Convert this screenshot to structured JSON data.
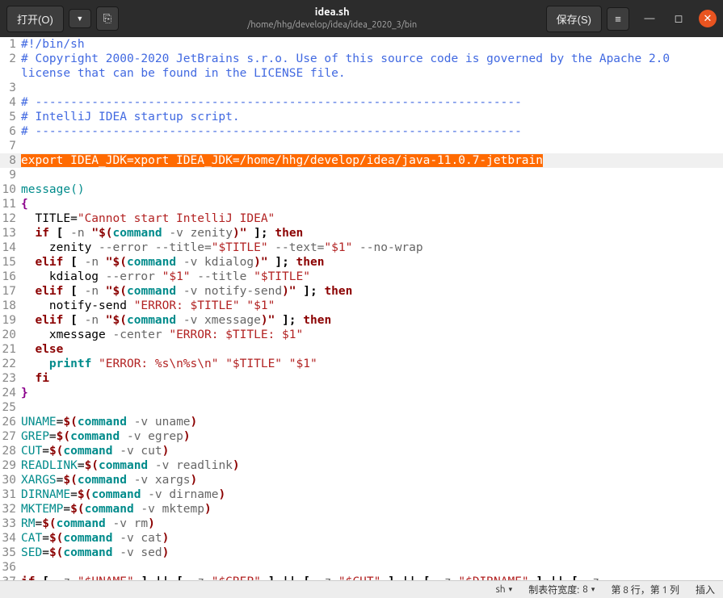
{
  "titlebar": {
    "open": "打开(O)",
    "save": "保存(S)",
    "filename": "idea.sh",
    "filepath": "/home/hhg/develop/idea/idea_2020_3/bin"
  },
  "code": {
    "l1": "#!/bin/sh",
    "l2": "# Copyright 2000-2020 JetBrains s.r.o. Use of this source code is governed by the Apache 2.0 license that can be found in the LICENSE file.",
    "l4": "# ---------------------------------------------------------------------",
    "l5": "# IntelliJ IDEA startup script.",
    "l6": "# ---------------------------------------------------------------------",
    "l8_sel": "export IDEA_JDK=xport IDEA_JDK=/home/hhg/develop/idea/java-11.0.7-jetbrain",
    "l10": "message()",
    "l11": "{",
    "l12_a": "  TITLE=",
    "l12_b": "\"Cannot start IntelliJ IDEA\"",
    "l13_a": "if",
    "l13_b": " [ ",
    "l13_c": "-n",
    "l13_d": "\"$(",
    "l13_e": "command",
    "l13_f": " -v zenity",
    "l13_g": ")\"",
    "l13_h": " ]; ",
    "l13_i": "then",
    "l14_a": "    zenity ",
    "l14_b": "--error --title=",
    "l14_c": "\"$TITLE\"",
    "l14_d": " --text=",
    "l14_e": "\"$1\"",
    "l14_f": " --no-wrap",
    "l15_a": "elif",
    "l15_b": " [ ",
    "l15_c": "-n",
    "l15_d": "\"$(",
    "l15_e": "command",
    "l15_f": " -v kdialog",
    "l15_g": ")\"",
    "l15_h": " ]; ",
    "l15_i": "then",
    "l16_a": "    kdialog ",
    "l16_b": "--error ",
    "l16_c": "\"$1\"",
    "l16_d": " --title ",
    "l16_e": "\"$TITLE\"",
    "l17_a": "elif",
    "l17_b": " [ ",
    "l17_c": "-n",
    "l17_d": "\"$(",
    "l17_e": "command",
    "l17_f": " -v notify-send",
    "l17_g": ")\"",
    "l17_h": " ]; ",
    "l17_i": "then",
    "l18_a": "    notify-send ",
    "l18_b": "\"ERROR: $TITLE\"",
    "l18_c": " ",
    "l18_d": "\"$1\"",
    "l19_a": "elif",
    "l19_b": " [ ",
    "l19_c": "-n",
    "l19_d": "\"$(",
    "l19_e": "command",
    "l19_f": " -v xmessage",
    "l19_g": ")\"",
    "l19_h": " ]; ",
    "l19_i": "then",
    "l20_a": "    xmessage ",
    "l20_b": "-center ",
    "l20_c": "\"ERROR: $TITLE: $1\"",
    "l21": "else",
    "l22_a": "printf",
    "l22_b": "\"ERROR: %s\\n%s\\n\"",
    "l22_c": "\"$TITLE\"",
    "l22_d": "\"$1\"",
    "l23": "fi",
    "l24": "}",
    "l26_a": "UNAME",
    "l26_b": "=",
    "l26_c": "$(",
    "l26_d": "command",
    "l26_e": " -v uname",
    "l26_f": ")",
    "l27_a": "GREP",
    "l27_b": "=",
    "l27_c": "$(",
    "l27_d": "command",
    "l27_e": " -v egrep",
    "l27_f": ")",
    "l28_a": "CUT",
    "l28_b": "=",
    "l28_c": "$(",
    "l28_d": "command",
    "l28_e": " -v cut",
    "l28_f": ")",
    "l29_a": "READLINK",
    "l29_b": "=",
    "l29_c": "$(",
    "l29_d": "command",
    "l29_e": " -v readlink",
    "l29_f": ")",
    "l30_a": "XARGS",
    "l30_b": "=",
    "l30_c": "$(",
    "l30_d": "command",
    "l30_e": " -v xargs",
    "l30_f": ")",
    "l31_a": "DIRNAME",
    "l31_b": "=",
    "l31_c": "$(",
    "l31_d": "command",
    "l31_e": " -v dirname",
    "l31_f": ")",
    "l32_a": "MKTEMP",
    "l32_b": "=",
    "l32_c": "$(",
    "l32_d": "command",
    "l32_e": " -v mktemp",
    "l32_f": ")",
    "l33_a": "RM",
    "l33_b": "=",
    "l33_c": "$(",
    "l33_d": "command",
    "l33_e": " -v rm",
    "l33_f": ")",
    "l34_a": "CAT",
    "l34_b": "=",
    "l34_c": "$(",
    "l34_d": "command",
    "l34_e": " -v cat",
    "l34_f": ")",
    "l35_a": "SED",
    "l35_b": "=",
    "l35_c": "$(",
    "l35_d": "command",
    "l35_e": " -v sed",
    "l35_f": ")",
    "l37_a": "if",
    "l37_b": " [ ",
    "l37_c": "-z",
    "l37_d": "\"$UNAME\"",
    "l37_e": " ] || [ ",
    "l37_f": "-z",
    "l37_g": "\"$GREP\"",
    "l37_h": " ] || [ ",
    "l37_i": "-z",
    "l37_j": "\"$CUT\"",
    "l37_k": " ] || [ ",
    "l37_l": "-z",
    "l37_m": "\"$DIRNAME\"",
    "l37_n": " ] || [ ",
    "l37_o": "-z"
  },
  "status": {
    "lang": "sh",
    "tab_label": "制表符宽度:",
    "tab_width": "8",
    "pos": "第 8 行，第 1 列",
    "mode": "插入"
  }
}
